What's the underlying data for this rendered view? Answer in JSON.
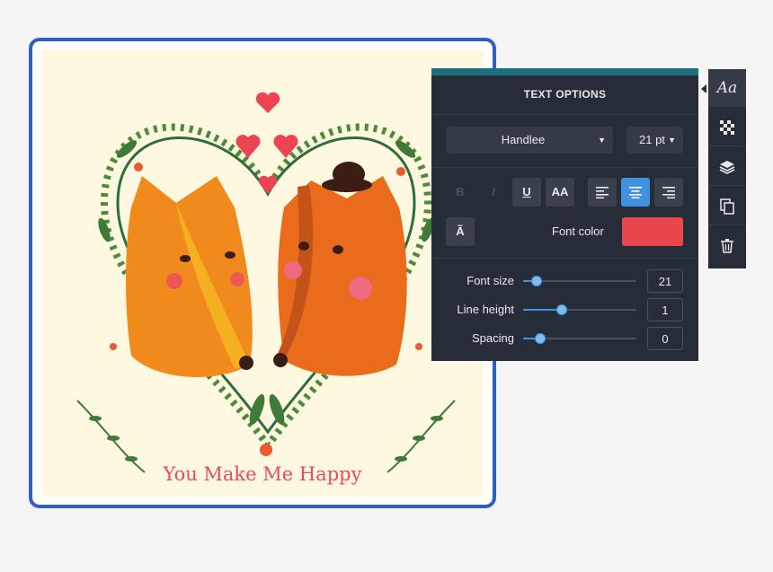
{
  "card": {
    "caption": "You Make Me Happy"
  },
  "text_options": {
    "title": "TEXT OPTIONS",
    "font_family": "Handlee",
    "font_size_select": "21 pt",
    "format_buttons": {
      "bold": "B",
      "italic": "I",
      "underline": "U",
      "uppercase": "AA",
      "shadow": "Ã"
    },
    "alignment_selected": "center",
    "font_color_label": "Font color",
    "font_color": "#e9464d",
    "sliders": [
      {
        "label": "Font size",
        "value": "21",
        "level": 0.12
      },
      {
        "label": "Line height",
        "value": "1",
        "level": 0.34
      },
      {
        "label": "Spacing",
        "value": "0",
        "level": 0.15
      }
    ]
  },
  "toolbar": {
    "icons": [
      "text-icon",
      "transparency-icon",
      "layers-icon",
      "duplicate-icon",
      "trash-icon"
    ],
    "text_icon_label": "Aa"
  },
  "colors": {
    "accent": "#3f92e0",
    "panel": "#272d38",
    "frame": "#2f5ec9"
  }
}
